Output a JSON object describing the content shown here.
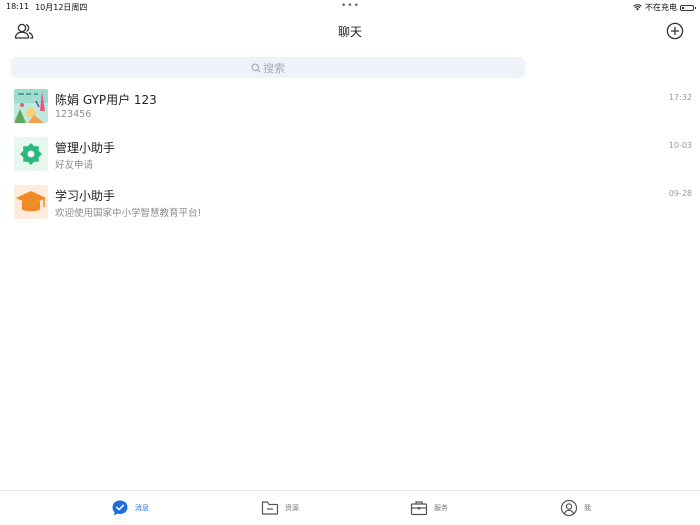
{
  "status_bar": {
    "time": "18:11",
    "date": "10月12日周四",
    "charging": "不在充电",
    "battery_level": 0.15
  },
  "header": {
    "title": "聊天"
  },
  "search": {
    "placeholder": "搜索"
  },
  "chats": [
    {
      "name": "陈娟 GYP用户 123",
      "preview": "123456",
      "time": "17:32",
      "avatar_icon": "user-photo-avatar"
    },
    {
      "name": "管理小助手",
      "preview": "好友申请",
      "time": "10-03",
      "avatar_icon": "gear-icon"
    },
    {
      "name": "学习小助手",
      "preview": "欢迎使用国家中小学智慧教育平台!",
      "time": "09-28",
      "avatar_icon": "graduation-cap-icon"
    }
  ],
  "tabs": [
    {
      "label": "消息",
      "icon": "message-icon",
      "active": true
    },
    {
      "label": "资源",
      "icon": "folder-icon",
      "active": false
    },
    {
      "label": "服务",
      "icon": "briefcase-icon",
      "active": false
    },
    {
      "label": "我",
      "icon": "profile-icon",
      "active": false
    }
  ],
  "colors": {
    "accent": "#1e6fd9",
    "search_bg": "#eef2f9",
    "gear_green": "#2db87d",
    "cap_orange": "#f08a24"
  }
}
